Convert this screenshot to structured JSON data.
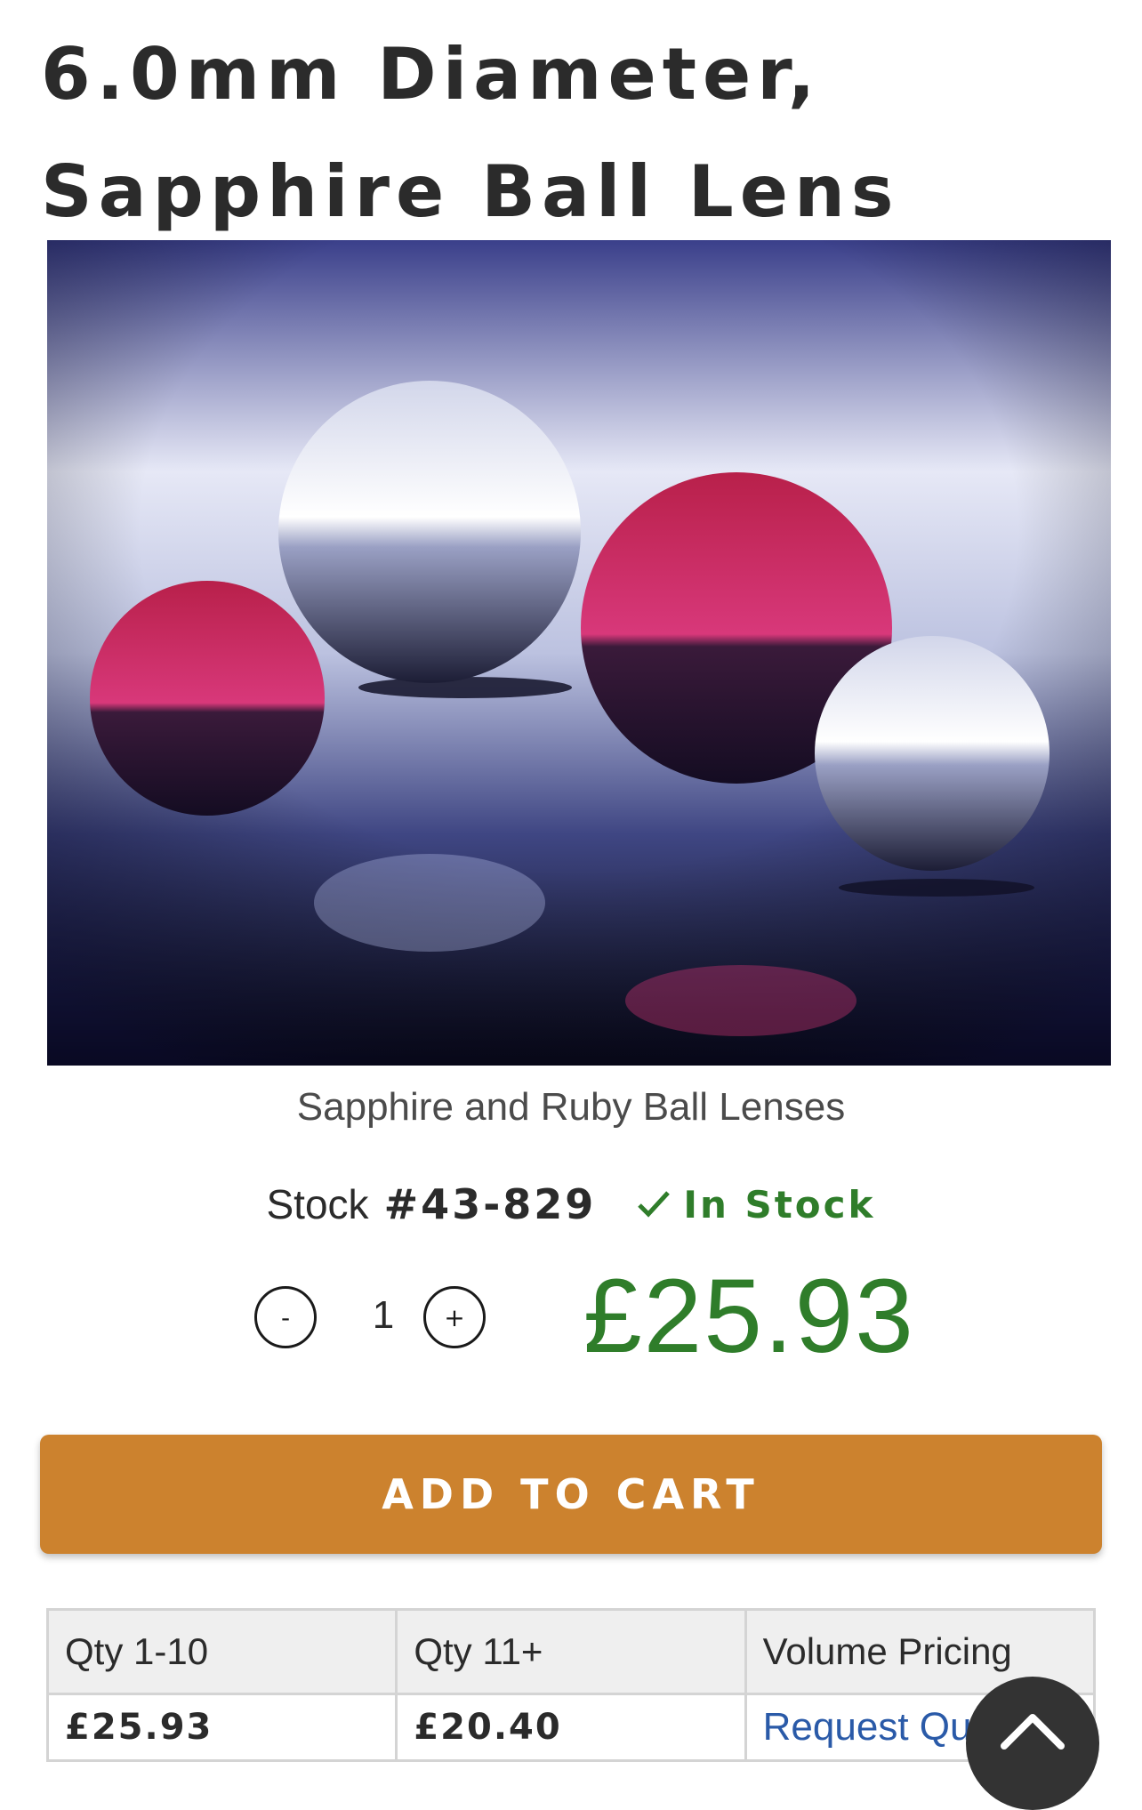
{
  "product": {
    "title_line1": "6.0mm Diameter,",
    "title_line2": "Sapphire Ball Lens",
    "image_caption": "Sapphire and Ruby Ball Lenses",
    "stock_label": "Stock",
    "stock_number": "#43-829",
    "availability": "In Stock",
    "quantity": "1",
    "price": "£25.93"
  },
  "controls": {
    "decrease_label": "-",
    "increase_label": "+",
    "add_to_cart_label": "ADD TO CART"
  },
  "pricing_table": {
    "headers": [
      "Qty 1-10",
      "Qty 11+",
      "Volume Pricing"
    ],
    "prices": [
      "£25.93",
      "£20.40"
    ],
    "quote_link": "Request Quote"
  },
  "icons": {
    "availability": "checkmark-icon",
    "back_to_top": "chevron-up-icon"
  },
  "colors": {
    "accent_green": "#2f7d2a",
    "cart_orange": "#cc822e",
    "link_blue": "#2a5aa8",
    "title_text": "#2b2b2b"
  }
}
